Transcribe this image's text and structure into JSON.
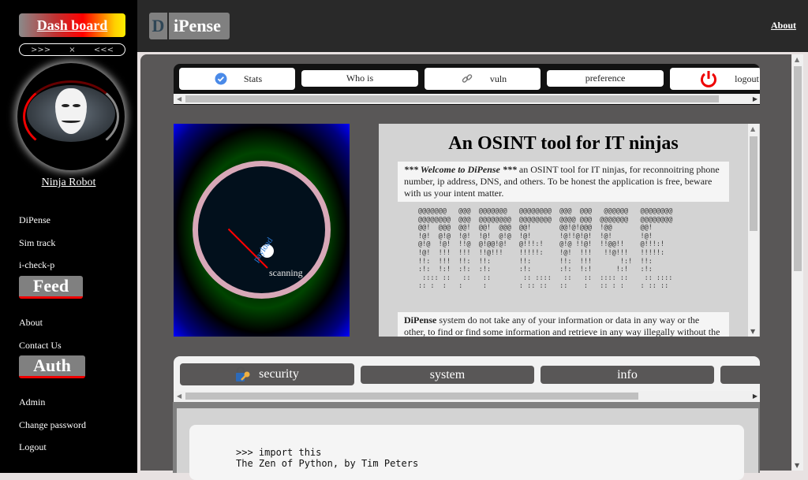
{
  "sidebar": {
    "dashboard_label": "Dash board",
    "toggle": {
      "left": ">>>",
      "close": "×",
      "right": "<<<"
    },
    "avatar_icon": "anonymous-mask-icon",
    "user_name": "Ninja Robot",
    "links_group1": [
      "DiPense",
      "Sim track",
      "i-check-p"
    ],
    "feed_heading": "Feed",
    "links_group2": [
      "About",
      "Contact Us"
    ],
    "auth_heading": "Auth",
    "links_group3": [
      "Admin",
      "Change password",
      "Logout"
    ]
  },
  "header": {
    "logo_first": "D",
    "logo_rest": "iPense",
    "about_link": "About"
  },
  "top_tabs": [
    {
      "label": "Stats",
      "icon": "check-circle-icon"
    },
    {
      "label": "Who is",
      "icon": ""
    },
    {
      "label": "vuln",
      "icon": "link-icon"
    },
    {
      "label": "preference",
      "icon": ""
    },
    {
      "label": "logout",
      "icon": "power-icon"
    }
  ],
  "radar": {
    "status": "scanning",
    "label": "payload"
  },
  "info": {
    "title": "An OSINT tool for IT ninjas",
    "intro_bold": "*** Welcome to DiPense ***",
    "intro_text": " an OSINT tool for IT ninjas, for reconnoitring phone number, ip address, DNS, and others. To be honest the application is free, beware with us your intent matter.",
    "ascii_art": "@@@@@@@   @@@  @@@@@@@   @@@@@@@@  @@@  @@@   @@@@@@   @@@@@@@@\n@@@@@@@@  @@@  @@@@@@@@  @@@@@@@@  @@@@ @@@  @@@@@@@   @@@@@@@@\n@@!  @@@  @@!  @@!  @@@  @@!       @@!@!@@@  !@@       @@!\n!@!  @!@  !@!  !@!  @!@  !@!       !@!!@!@!  !@!       !@!\n@!@  !@!  !!@  @!@@!@!   @!!!:!    @!@ !!@!  !!@@!!    @!!!:!\n!@!  !!!  !!!  !!@!!!    !!!!!:    !@!  !!!   !!@!!!   !!!!!:\n!!:  !!!  !!:  !!:       !!:       !!:  !!!       !:!  !!:\n:!:  !:!  :!:  :!:       :!:       :!:  !:!      !:!   :!:\n :::: ::   ::   ::        :: ::::   ::   ::  :::: ::    :: ::::\n:: :  :   :     :        : :: ::   ::    :   :: : :    : :: ::",
    "disclaimer_bold": "DiPense",
    "disclaimer_text": " system do not take any of your information or data in any way or the other, to find or find some information and retrieve in any way illegally without the"
  },
  "bottom_tabs": [
    {
      "label": "security",
      "icon": "lock-key-icon"
    },
    {
      "label": "system",
      "icon": ""
    },
    {
      "label": "info",
      "icon": ""
    },
    {
      "label": "",
      "icon": ""
    }
  ],
  "console": {
    "lines": ">>> import this\nThe Zen of Python, by Tim Peters"
  }
}
